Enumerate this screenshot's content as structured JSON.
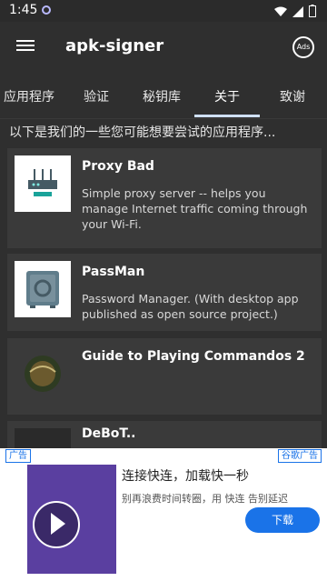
{
  "status": {
    "time": "1:45"
  },
  "appbar": {
    "title": "apk-signer",
    "ads_label": "Ads"
  },
  "tabs": [
    "应用程序",
    "验证",
    "秘钥库",
    "关于",
    "致谢"
  ],
  "intro": "以下是我们的一些您可能想要尝试的应用程序...",
  "cards": [
    {
      "title": "Proxy Bad",
      "desc": "Simple proxy server -- helps you manage Internet traffic coming through your Wi-Fi."
    },
    {
      "title": "PassMan",
      "desc": "Password Manager. (With desktop app published as open source project.)"
    },
    {
      "title": "Guide to Playing Commandos 2",
      "desc": ""
    },
    {
      "title": "DeBoT..",
      "desc": ""
    }
  ],
  "ad": {
    "tag": "广告",
    "google": "谷歌广告",
    "title": "连接快连，加载快一秒",
    "subtitle": "别再浪费时间转圈，用 快连 告别延迟",
    "cta": "下载"
  }
}
